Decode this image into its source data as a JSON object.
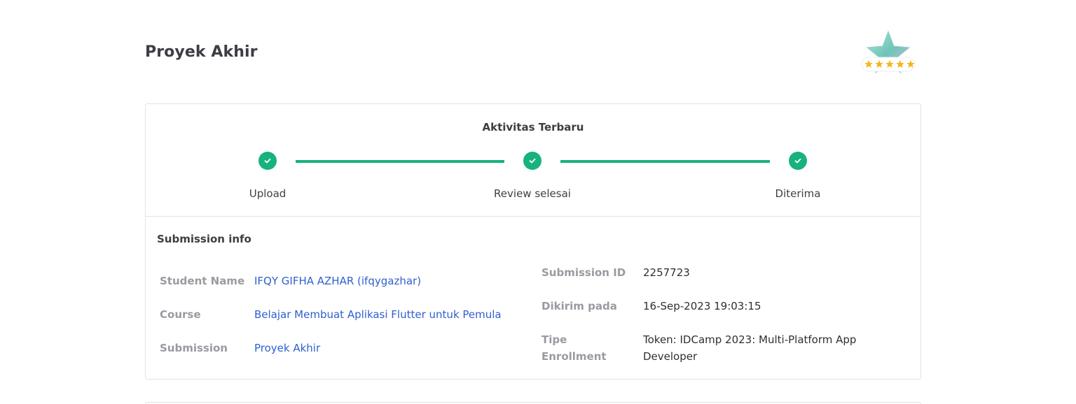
{
  "page": {
    "title": "Proyek Akhir"
  },
  "progress": {
    "title": "Aktivitas Terbaru",
    "steps": [
      {
        "label": "Upload",
        "status": "done"
      },
      {
        "label": "Review selesai",
        "status": "done"
      },
      {
        "label": "Diterima",
        "status": "done"
      }
    ],
    "accent_color": "#17b280"
  },
  "submission_info": {
    "title": "Submission info",
    "left": [
      {
        "label": "Student Name",
        "value": "IFQY GIFHA AZHAR (ifqygazhar)"
      },
      {
        "label": "Course",
        "value": "Belajar Membuat Aplikasi Flutter untuk Pemula"
      },
      {
        "label": "Submission",
        "value": "Proyek Akhir"
      }
    ],
    "right": [
      {
        "label": "Submission ID",
        "value": "2257723"
      },
      {
        "label": "Dikirim pada",
        "value": "16-Sep-2023 19:03:15"
      },
      {
        "label_line1": "Tipe",
        "label_line2": "Enrollment",
        "value_line1": "Token: IDCamp 2023: Multi-Platform App",
        "value_line2": "Developer"
      }
    ]
  },
  "colors": {
    "link": "#2f5fd0",
    "muted_label": "#9a9aa1",
    "border": "#e2e2e6"
  },
  "badge": {
    "icon": "star-rating-badge-icon",
    "rating": 5,
    "max_rating": 5
  }
}
